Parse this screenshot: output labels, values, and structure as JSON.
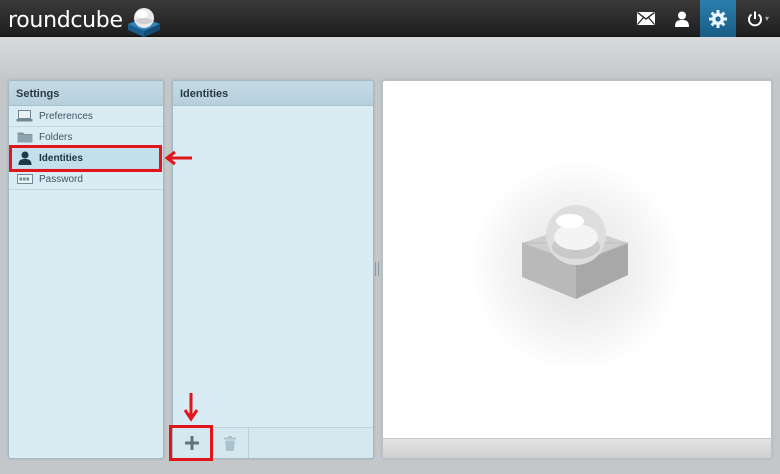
{
  "app": {
    "logo_text": "roundcube"
  },
  "topnav": {
    "items": [
      {
        "name": "mail",
        "icon": "envelope-icon"
      },
      {
        "name": "contacts",
        "icon": "person-icon"
      },
      {
        "name": "settings",
        "icon": "gear-icon",
        "active": true
      },
      {
        "name": "logout",
        "icon": "power-icon"
      }
    ]
  },
  "settings_panel": {
    "title": "Settings",
    "items": [
      {
        "label": "Preferences",
        "icon": "laptop-icon"
      },
      {
        "label": "Folders",
        "icon": "folder-icon"
      },
      {
        "label": "Identities",
        "icon": "person-icon",
        "selected": true
      },
      {
        "label": "Password",
        "icon": "password-icon"
      }
    ]
  },
  "identities_panel": {
    "title": "Identities",
    "footer": [
      {
        "name": "add",
        "icon": "plus-icon"
      },
      {
        "name": "delete",
        "icon": "trash-icon",
        "disabled": true
      }
    ]
  },
  "colors": {
    "accent": "#1c6d9a",
    "panel_bg": "#d9ecf3",
    "annotation_red": "#e0161b"
  }
}
